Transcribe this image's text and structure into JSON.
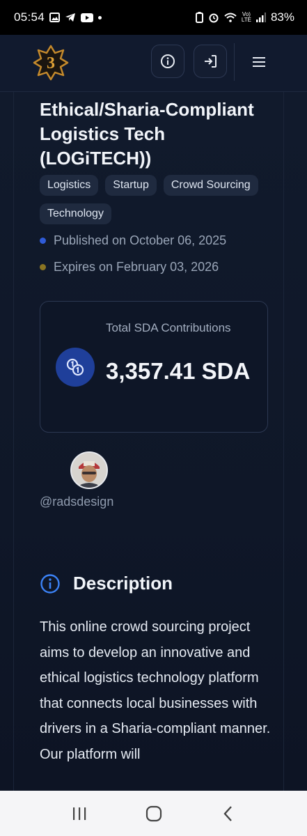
{
  "status_bar": {
    "time": "05:54",
    "battery": "83%",
    "network": "LTE"
  },
  "header": {
    "logo_icon": "brand-star-logo",
    "info_icon": "info-icon",
    "login_icon": "login-icon",
    "menu_icon": "menu-icon"
  },
  "project": {
    "title": "Ethical/Sharia-Compliant Logistics Tech (LOGiTECH))",
    "tags": [
      "Logistics",
      "Startup",
      "Crowd Sourcing",
      "Technology"
    ],
    "published": "Published on October 06, 2025",
    "expires": "Expires on February 03, 2026"
  },
  "contributions": {
    "label": "Total SDA Contributions",
    "value": "3,357.41 SDA"
  },
  "author": {
    "username": "@radsdesign"
  },
  "description": {
    "heading": "Description",
    "body": "This online crowd sourcing project aims to develop an innovative and ethical logistics technology platform that connects local businesses with drivers in a Sharia-compliant manner. Our platform will"
  },
  "colors": {
    "background": "#0d1424",
    "accent_blue": "#2f5bd8",
    "gold": "#c58a2c"
  }
}
